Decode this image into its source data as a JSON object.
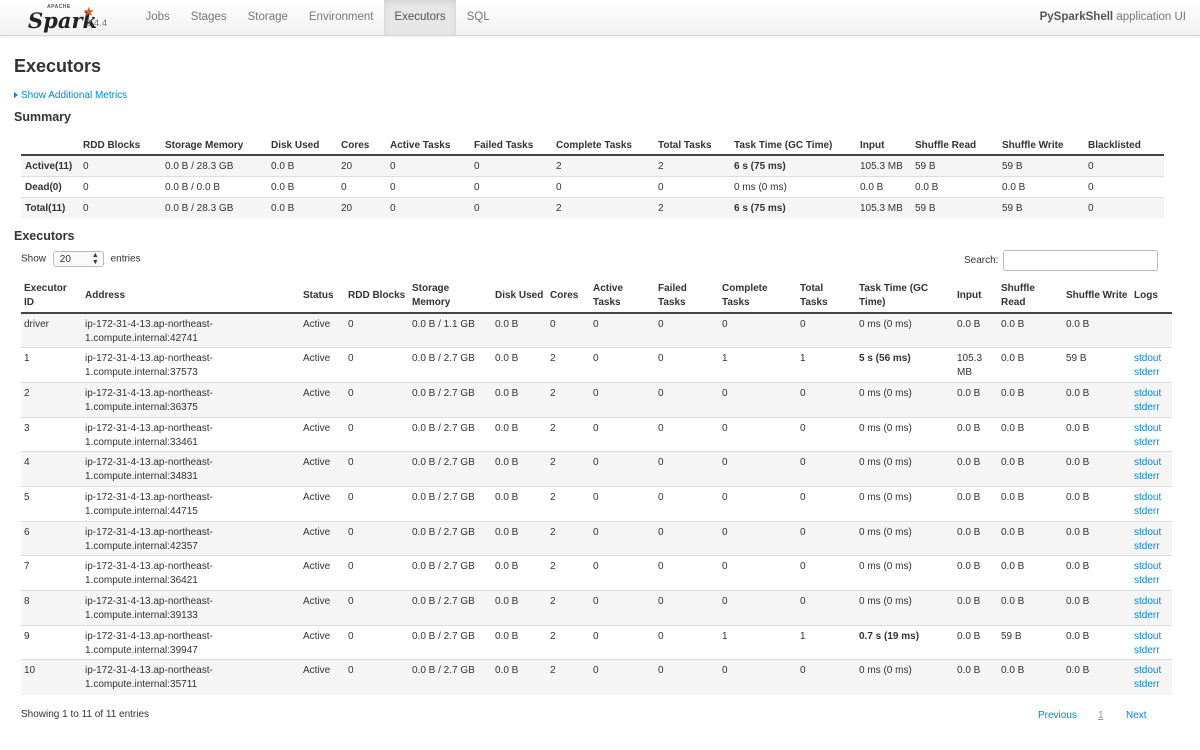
{
  "brand": {
    "apache": "APACHE",
    "name": "Spark",
    "version": "2.4.4"
  },
  "nav": [
    {
      "label": "Jobs",
      "active": false
    },
    {
      "label": "Stages",
      "active": false
    },
    {
      "label": "Storage",
      "active": false
    },
    {
      "label": "Environment",
      "active": false
    },
    {
      "label": "Executors",
      "active": true
    },
    {
      "label": "SQL",
      "active": false
    }
  ],
  "app_name": "PySparkShell",
  "app_suffix": " application UI",
  "page_title": "Executors",
  "additional_metrics": "Show Additional Metrics",
  "summary": {
    "heading": "Summary",
    "columns": [
      "",
      "RDD Blocks",
      "Storage Memory",
      "Disk Used",
      "Cores",
      "Active Tasks",
      "Failed Tasks",
      "Complete Tasks",
      "Total Tasks",
      "Task Time (GC Time)",
      "Input",
      "Shuffle Read",
      "Shuffle Write",
      "Blacklisted"
    ],
    "rows": [
      [
        "Active(11)",
        "0",
        "0.0 B / 28.3 GB",
        "0.0 B",
        "20",
        "0",
        "0",
        "2",
        "2",
        "6 s (75 ms)",
        "105.3 MB",
        "59 B",
        "59 B",
        "0"
      ],
      [
        "Dead(0)",
        "0",
        "0.0 B / 0.0 B",
        "0.0 B",
        "0",
        "0",
        "0",
        "0",
        "0",
        "0 ms (0 ms)",
        "0.0 B",
        "0.0 B",
        "0.0 B",
        "0"
      ],
      [
        "Total(11)",
        "0",
        "0.0 B / 28.3 GB",
        "0.0 B",
        "20",
        "0",
        "0",
        "2",
        "2",
        "6 s (75 ms)",
        "105.3 MB",
        "59 B",
        "59 B",
        "0"
      ]
    ],
    "bold_task_time_rows": [
      0,
      2
    ]
  },
  "executors": {
    "heading": "Executors",
    "show_label": "Show",
    "page_size": "20",
    "entries_label": "entries",
    "search_label": "Search:",
    "search_value": "",
    "columns": [
      "Executor ID",
      "Address",
      "Status",
      "RDD Blocks",
      "Storage Memory",
      "Disk Used",
      "Cores",
      "Active Tasks",
      "Failed Tasks",
      "Complete Tasks",
      "Total Tasks",
      "Task Time (GC Time)",
      "Input",
      "Shuffle Read",
      "Shuffle Write",
      "Logs"
    ],
    "rows": [
      {
        "id": "driver",
        "address": "ip-172-31-4-13.ap-northeast-1.compute.internal:42741",
        "status": "Active",
        "rdd": "0",
        "storage": "0.0 B / 1.1 GB",
        "disk": "0.0 B",
        "cores": "0",
        "active": "0",
        "failed": "0",
        "complete": "0",
        "total": "0",
        "task_time": "0 ms (0 ms)",
        "bold_time": false,
        "input": "0.0 B",
        "shuffle_read": "0.0 B",
        "shuffle_write": "0.0 B",
        "logs": []
      },
      {
        "id": "1",
        "address": "ip-172-31-4-13.ap-northeast-1.compute.internal:37573",
        "status": "Active",
        "rdd": "0",
        "storage": "0.0 B / 2.7 GB",
        "disk": "0.0 B",
        "cores": "2",
        "active": "0",
        "failed": "0",
        "complete": "1",
        "total": "1",
        "task_time": "5 s (56 ms)",
        "bold_time": true,
        "input": "105.3 MB",
        "shuffle_read": "0.0 B",
        "shuffle_write": "59 B",
        "logs": [
          "stdout",
          "stderr"
        ]
      },
      {
        "id": "2",
        "address": "ip-172-31-4-13.ap-northeast-1.compute.internal:36375",
        "status": "Active",
        "rdd": "0",
        "storage": "0.0 B / 2.7 GB",
        "disk": "0.0 B",
        "cores": "2",
        "active": "0",
        "failed": "0",
        "complete": "0",
        "total": "0",
        "task_time": "0 ms (0 ms)",
        "bold_time": false,
        "input": "0.0 B",
        "shuffle_read": "0.0 B",
        "shuffle_write": "0.0 B",
        "logs": [
          "stdout",
          "stderr"
        ]
      },
      {
        "id": "3",
        "address": "ip-172-31-4-13.ap-northeast-1.compute.internal:33461",
        "status": "Active",
        "rdd": "0",
        "storage": "0.0 B / 2.7 GB",
        "disk": "0.0 B",
        "cores": "2",
        "active": "0",
        "failed": "0",
        "complete": "0",
        "total": "0",
        "task_time": "0 ms (0 ms)",
        "bold_time": false,
        "input": "0.0 B",
        "shuffle_read": "0.0 B",
        "shuffle_write": "0.0 B",
        "logs": [
          "stdout",
          "stderr"
        ]
      },
      {
        "id": "4",
        "address": "ip-172-31-4-13.ap-northeast-1.compute.internal:34831",
        "status": "Active",
        "rdd": "0",
        "storage": "0.0 B / 2.7 GB",
        "disk": "0.0 B",
        "cores": "2",
        "active": "0",
        "failed": "0",
        "complete": "0",
        "total": "0",
        "task_time": "0 ms (0 ms)",
        "bold_time": false,
        "input": "0.0 B",
        "shuffle_read": "0.0 B",
        "shuffle_write": "0.0 B",
        "logs": [
          "stdout",
          "stderr"
        ]
      },
      {
        "id": "5",
        "address": "ip-172-31-4-13.ap-northeast-1.compute.internal:44715",
        "status": "Active",
        "rdd": "0",
        "storage": "0.0 B / 2.7 GB",
        "disk": "0.0 B",
        "cores": "2",
        "active": "0",
        "failed": "0",
        "complete": "0",
        "total": "0",
        "task_time": "0 ms (0 ms)",
        "bold_time": false,
        "input": "0.0 B",
        "shuffle_read": "0.0 B",
        "shuffle_write": "0.0 B",
        "logs": [
          "stdout",
          "stderr"
        ]
      },
      {
        "id": "6",
        "address": "ip-172-31-4-13.ap-northeast-1.compute.internal:42357",
        "status": "Active",
        "rdd": "0",
        "storage": "0.0 B / 2.7 GB",
        "disk": "0.0 B",
        "cores": "2",
        "active": "0",
        "failed": "0",
        "complete": "0",
        "total": "0",
        "task_time": "0 ms (0 ms)",
        "bold_time": false,
        "input": "0.0 B",
        "shuffle_read": "0.0 B",
        "shuffle_write": "0.0 B",
        "logs": [
          "stdout",
          "stderr"
        ]
      },
      {
        "id": "7",
        "address": "ip-172-31-4-13.ap-northeast-1.compute.internal:36421",
        "status": "Active",
        "rdd": "0",
        "storage": "0.0 B / 2.7 GB",
        "disk": "0.0 B",
        "cores": "2",
        "active": "0",
        "failed": "0",
        "complete": "0",
        "total": "0",
        "task_time": "0 ms (0 ms)",
        "bold_time": false,
        "input": "0.0 B",
        "shuffle_read": "0.0 B",
        "shuffle_write": "0.0 B",
        "logs": [
          "stdout",
          "stderr"
        ]
      },
      {
        "id": "8",
        "address": "ip-172-31-4-13.ap-northeast-1.compute.internal:39133",
        "status": "Active",
        "rdd": "0",
        "storage": "0.0 B / 2.7 GB",
        "disk": "0.0 B",
        "cores": "2",
        "active": "0",
        "failed": "0",
        "complete": "0",
        "total": "0",
        "task_time": "0 ms (0 ms)",
        "bold_time": false,
        "input": "0.0 B",
        "shuffle_read": "0.0 B",
        "shuffle_write": "0.0 B",
        "logs": [
          "stdout",
          "stderr"
        ]
      },
      {
        "id": "9",
        "address": "ip-172-31-4-13.ap-northeast-1.compute.internal:39947",
        "status": "Active",
        "rdd": "0",
        "storage": "0.0 B / 2.7 GB",
        "disk": "0.0 B",
        "cores": "2",
        "active": "0",
        "failed": "0",
        "complete": "1",
        "total": "1",
        "task_time": "0.7 s (19 ms)",
        "bold_time": true,
        "input": "0.0 B",
        "shuffle_read": "59 B",
        "shuffle_write": "0.0 B",
        "logs": [
          "stdout",
          "stderr"
        ]
      },
      {
        "id": "10",
        "address": "ip-172-31-4-13.ap-northeast-1.compute.internal:35711",
        "status": "Active",
        "rdd": "0",
        "storage": "0.0 B / 2.7 GB",
        "disk": "0.0 B",
        "cores": "2",
        "active": "0",
        "failed": "0",
        "complete": "0",
        "total": "0",
        "task_time": "0 ms (0 ms)",
        "bold_time": false,
        "input": "0.0 B",
        "shuffle_read": "0.0 B",
        "shuffle_write": "0.0 B",
        "logs": [
          "stdout",
          "stderr"
        ]
      }
    ],
    "footer_info": "Showing 1 to 11 of 11 entries",
    "pager": {
      "previous": "Previous",
      "current": "1",
      "next": "Next"
    }
  },
  "colors": {
    "link": "#0088cc",
    "spark_orange": "#e25a1c",
    "stripe": "#f5f5f5"
  },
  "icons": [
    "spark-logo-star-icon",
    "expand-triangle-icon",
    "select-chevron-icon"
  ]
}
